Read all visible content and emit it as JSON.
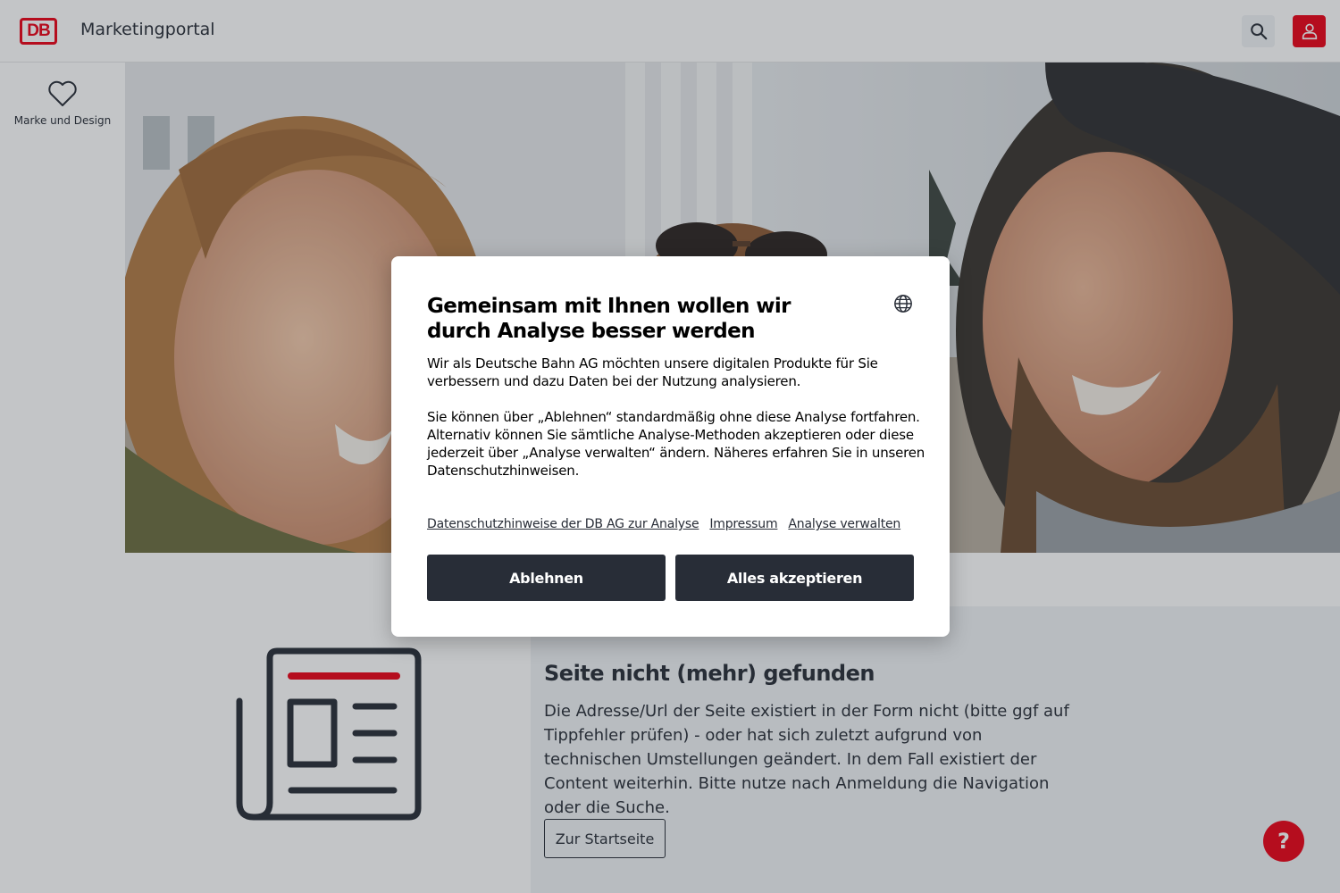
{
  "header": {
    "logo_text": "DB",
    "app_title": "Marketingportal",
    "search_icon": "search-icon",
    "user_icon": "user-icon",
    "brand_color": "#ec0016"
  },
  "sidebar": {
    "items": [
      {
        "label": "Marke und Design",
        "icon": "heart-icon"
      }
    ]
  },
  "main": {
    "error_title": "Seite nicht (mehr) gefunden",
    "error_text": "Die Adresse/Url der Seite existiert in der Form nicht (bitte ggf auf Tippfehler prüfen)  - oder hat sich zuletzt aufgrund von technischen Umstellungen geändert. In dem Fall existiert der Content weiterhin. Bitte nutze nach Anmeldung die Navigation oder die Suche.",
    "home_button": "Zur Startseite",
    "illustration_icon": "newspaper-icon"
  },
  "help": {
    "label": "?"
  },
  "consent": {
    "title": "Gemeinsam mit Ihnen wollen wir durch Analyse besser werden",
    "language_icon": "globe-icon",
    "paragraph_1": "Wir als Deutsche Bahn AG möchten unsere digitalen Produkte für Sie verbessern und dazu Daten bei der Nutzung analysieren.",
    "paragraph_2": "Sie können über „Ablehnen“ standardmäßig ohne diese Analyse fortfahren.",
    "paragraph_3": "Alternativ können Sie sämtliche Analyse-Methoden akzeptieren oder diese jederzeit über „Analyse verwalten“ ändern. Näheres erfahren Sie in unseren Datenschutzhinweisen.",
    "links": [
      "Datenschutzhinweise der DB AG zur Analyse",
      "Impressum",
      "Analyse verwalten"
    ],
    "decline_label": "Ablehnen",
    "accept_label": "Alles akzeptieren"
  }
}
